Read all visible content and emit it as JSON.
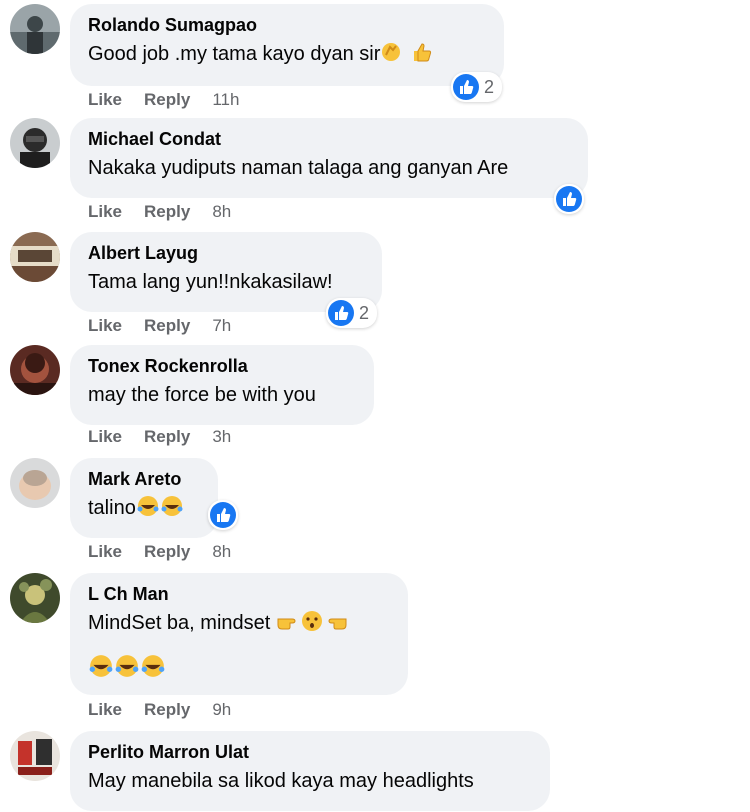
{
  "actions": {
    "like": "Like",
    "reply": "Reply"
  },
  "colors": {
    "bubble": "#f0f2f5",
    "like_blue": "#1877f2",
    "meta_gray": "#65676b"
  },
  "comments": [
    {
      "author": "Rolando Sumagpao",
      "text": "Good job .my tama kayo dyan sir",
      "emojis": [
        "clapping-hands",
        "thumbs-up"
      ],
      "reactions": {
        "type": "like",
        "count": "2"
      },
      "time": "11h"
    },
    {
      "author": "Michael Condat",
      "text": "Nakaka yudiputs naman talaga ang ganyan Are",
      "reactions": {
        "type": "like",
        "count": ""
      },
      "time": "8h"
    },
    {
      "author": "Albert Layug",
      "text": "Tama lang yun!!nkakasilaw!",
      "reactions": {
        "type": "like",
        "count": "2"
      },
      "time": "7h"
    },
    {
      "author": "Tonex Rockenrolla",
      "text": "may the force be with you",
      "time": "3h"
    },
    {
      "author": "Mark Areto",
      "text": "talino",
      "emojis": [
        "rofl",
        "rofl"
      ],
      "reactions": {
        "type": "like",
        "count": ""
      },
      "time": "8h"
    },
    {
      "author": "L Ch Man",
      "text": "MindSet ba, mindset",
      "emojis": [
        "pointing-right",
        "worried-face",
        "pointing-left"
      ],
      "second_line_emojis": [
        "rofl",
        "rofl",
        "rofl"
      ],
      "time": "9h"
    },
    {
      "author": "Perlito Marron Ulat",
      "text": "May manebila sa likod kaya may headlights"
    }
  ]
}
